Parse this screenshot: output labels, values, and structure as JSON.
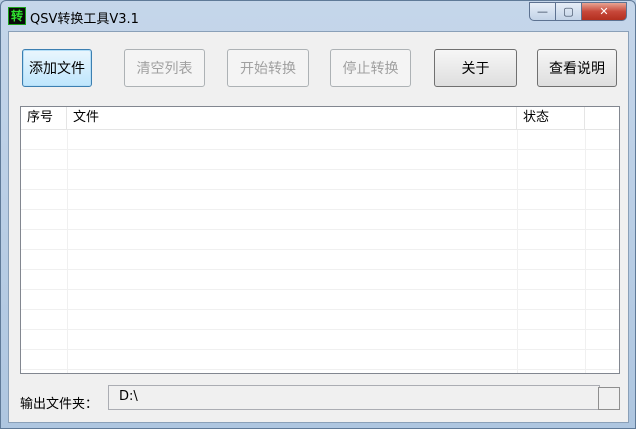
{
  "window": {
    "title": "QSV转换工具V3.1",
    "app_icon_glyph": "转"
  },
  "caption_buttons": {
    "minimize_glyph": "—",
    "maximize_glyph": "▢",
    "close_glyph": "✕"
  },
  "toolbar": {
    "add_files": "添加文件",
    "clear_list": "清空列表",
    "start_convert": "开始转换",
    "stop_convert": "停止转换",
    "about": "关于",
    "view_help": "查看说明"
  },
  "file_list": {
    "columns": [
      "序号",
      "文件",
      "状态",
      ""
    ],
    "rows": []
  },
  "output": {
    "label": "输出文件夹：",
    "value": "D:\\"
  },
  "colors": {
    "focus_border": "#3c7fb1",
    "disabled_text": "#a0a0a0",
    "close_red": "#c7483a"
  }
}
